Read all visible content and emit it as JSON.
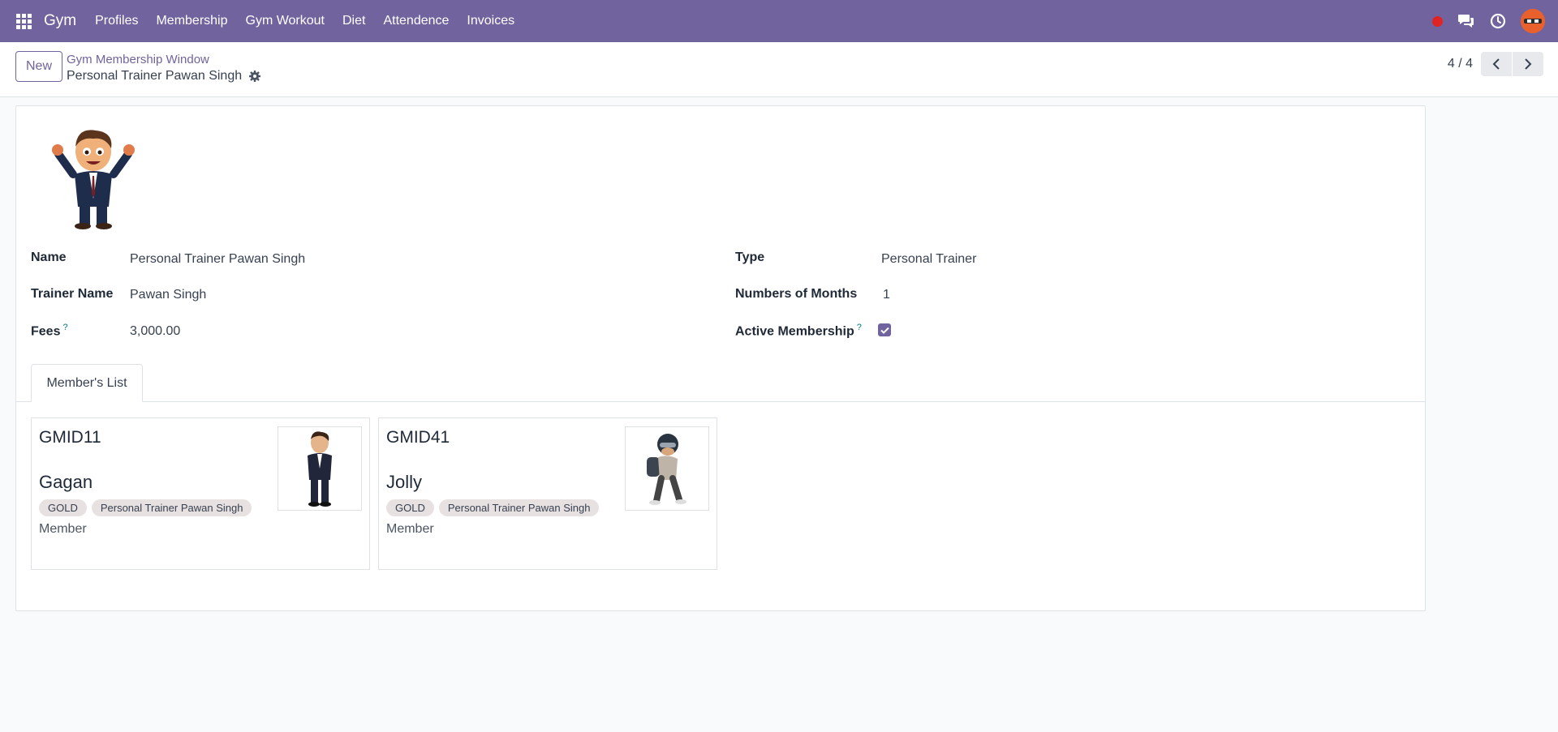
{
  "navbar": {
    "app_name": "Gym",
    "menu": [
      "Profiles",
      "Membership",
      "Gym Workout",
      "Diet",
      "Attendence",
      "Invoices"
    ]
  },
  "control": {
    "new_label": "New",
    "breadcrumb_parent": "Gym Membership Window",
    "breadcrumb_current": "Personal Trainer Pawan Singh",
    "pager": "4 / 4"
  },
  "form": {
    "name_label": "Name",
    "name_value": "Personal Trainer Pawan Singh",
    "trainer_label": "Trainer Name",
    "trainer_value": "Pawan Singh",
    "fees_label": "Fees",
    "fees_value": "3,000.00",
    "type_label": "Type",
    "type_value": "Personal Trainer",
    "months_label": "Numbers of Months",
    "months_value": "1",
    "active_label": "Active Membership",
    "active_value": true,
    "tooltip_mark": "?"
  },
  "tabs": [
    "Member's List"
  ],
  "members": [
    {
      "id": "GMID11",
      "name": "Gagan",
      "tags": [
        "GOLD",
        "Personal Trainer Pawan Singh"
      ],
      "role": "Member"
    },
    {
      "id": "GMID41",
      "name": "Jolly",
      "tags": [
        "GOLD",
        "Personal Trainer Pawan Singh"
      ],
      "role": "Member"
    }
  ],
  "colors": {
    "brand": "#71639e",
    "record": "#e02424"
  }
}
